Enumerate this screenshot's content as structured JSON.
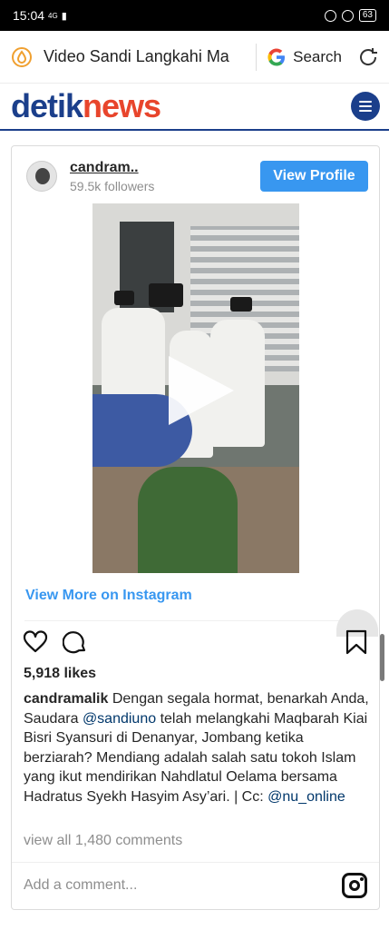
{
  "status": {
    "time": "15:04",
    "network": "4G",
    "battery": "63"
  },
  "browser": {
    "title": "Video Sandi Langkahi Ma",
    "search_label": "Search",
    "google_logo": "G"
  },
  "site": {
    "logo_part1": "detik",
    "logo_part2": "news"
  },
  "instagram": {
    "username": "candram..",
    "followers": "59.5k followers",
    "view_profile": "View Profile",
    "view_more": "View More on Instagram",
    "likes": "5,918 likes",
    "caption_user": "candramalik",
    "caption_text_1": " Dengan segala hormat, benarkah Anda, Saudara ",
    "mention_1": "@sandiuno",
    "caption_text_2": " telah melangkahi Maqbarah Kiai Bisri Syansuri di Denanyar, Jombang ketika berziarah? Mendiang adalah salah satu tokoh Islam yang ikut mendirikan Nahdlatul Oelama bersama Hadratus Syekh Hasyim Asy’ari. | Cc: ",
    "mention_2": "@nu_online",
    "view_comments": "view all 1,480 comments",
    "add_comment_placeholder": "Add a comment..."
  }
}
